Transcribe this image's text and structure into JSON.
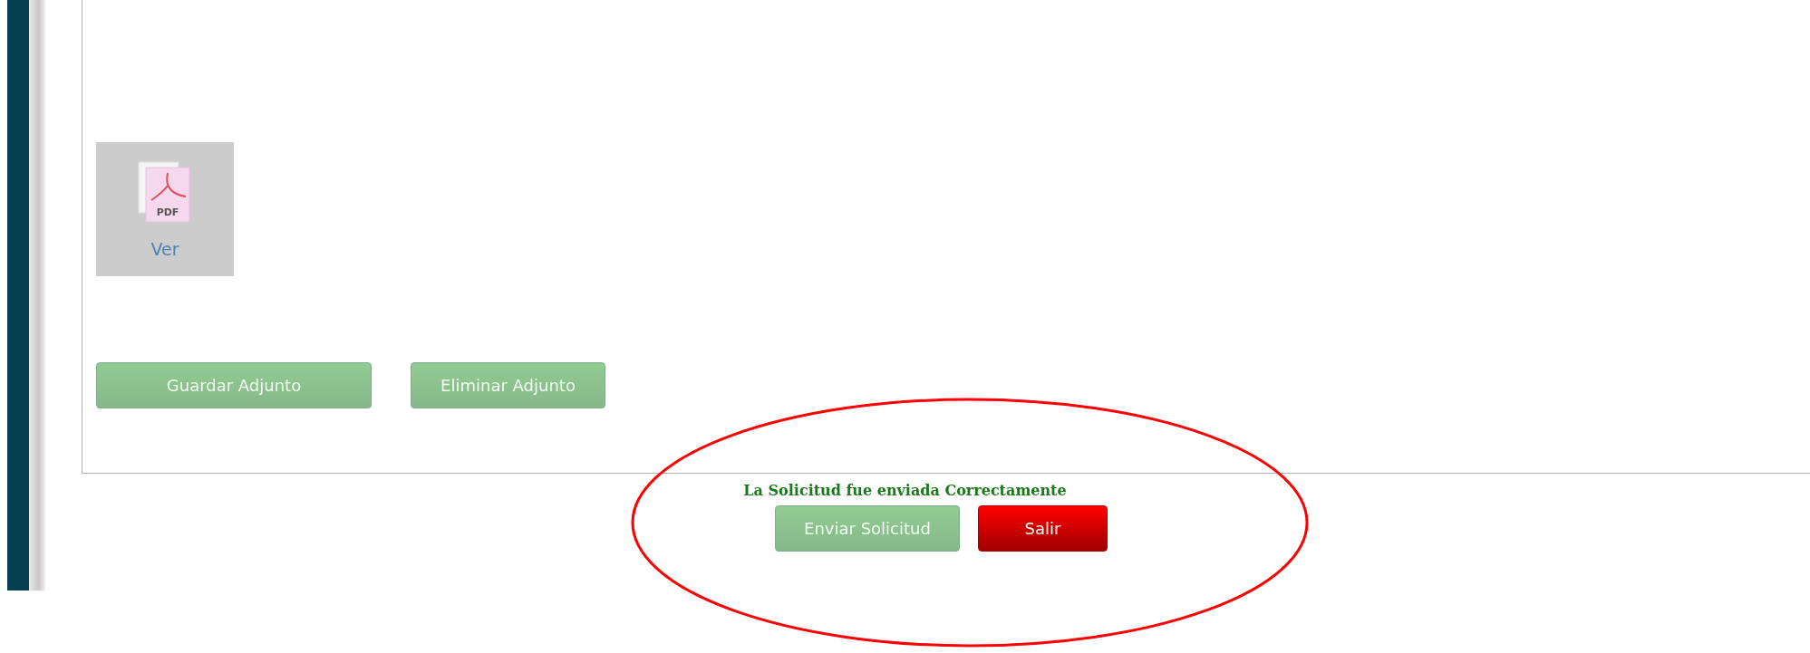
{
  "attachment": {
    "file_type": "PDF",
    "link": "Ver"
  },
  "attachment_buttons": [
    {
      "label": "Guardar Adjunto"
    },
    {
      "label": "Eliminar Adjunto"
    }
  ],
  "message": "La Solicitud fue enviada Correctamente",
  "buttons": [
    {
      "label": "Enviar Solicitud",
      "kind": "success"
    },
    {
      "label": "Salir",
      "kind": "danger"
    }
  ]
}
